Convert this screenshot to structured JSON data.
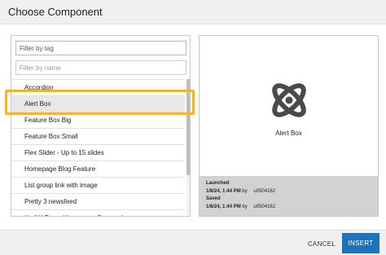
{
  "dialog": {
    "title": "Choose Component"
  },
  "filters": {
    "tag_placeholder": "Filter by tag",
    "name_placeholder": "Filter by name"
  },
  "list": {
    "items": [
      "Accordion",
      "Alert Box",
      "Feature Box Big",
      "Feature Box Small",
      "Flex Slider - Up to 15 slides",
      "Homepage Blog Feature",
      "List group link with image",
      "Pretty 3 newsfeed",
      "U of U Press Homepage Carousel"
    ],
    "selected_label": "Alert Box"
  },
  "preview": {
    "icon": "atom-icon",
    "name": "Alert Box",
    "launched_label": "Launched",
    "launched_datetime": "1/8/24, 1:44 PM",
    "launched_by_label": "by",
    "launched_user": "u0504162",
    "saved_label": "Saved",
    "saved_datetime": "1/8/24, 1:44 PM",
    "saved_by_label": "by",
    "saved_user": "u0504162"
  },
  "footer": {
    "cancel_label": "CANCEL",
    "insert_label": "INSERT"
  },
  "colors": {
    "accent": "#1e73b9",
    "highlight": "#f2b233",
    "icon": "#4a4a4a"
  }
}
